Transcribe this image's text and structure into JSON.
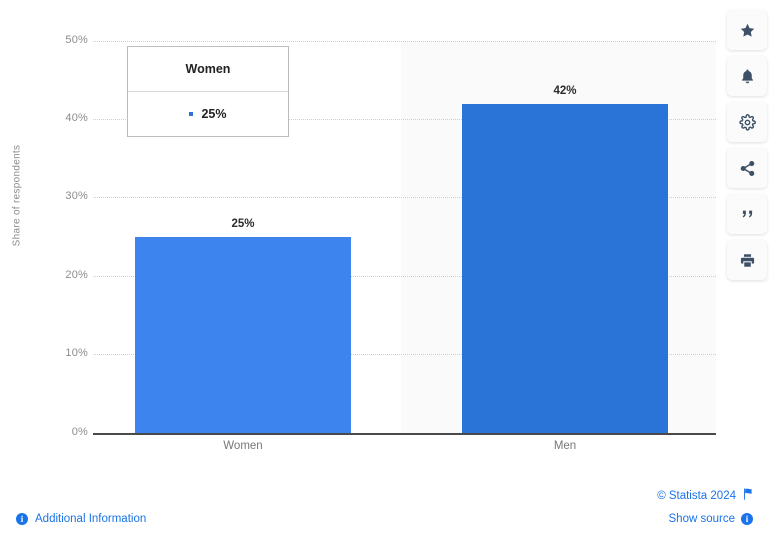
{
  "chart_data": {
    "type": "bar",
    "categories": [
      "Women",
      "Men"
    ],
    "values": [
      25,
      42
    ],
    "value_labels": [
      "25%",
      "42%"
    ],
    "title": "",
    "xlabel": "",
    "ylabel": "Share of respondents",
    "ylim": [
      0,
      50
    ],
    "ytick_labels": [
      "0%",
      "10%",
      "20%",
      "30%",
      "40%",
      "50%"
    ],
    "ytick_values": [
      0,
      10,
      20,
      30,
      40,
      50
    ],
    "grid": true,
    "legend": "none",
    "series_colors": [
      "#3d84ef",
      "#2974d6"
    ],
    "highlighted_category": "Men"
  },
  "tooltip": {
    "header": "Women",
    "value": "25%",
    "marker_color": "#2974d6"
  },
  "action_rail": [
    {
      "name": "star-icon",
      "label": "Add to favorites"
    },
    {
      "name": "bell-icon",
      "label": "Notifications"
    },
    {
      "name": "gear-icon",
      "label": "Settings"
    },
    {
      "name": "share-icon",
      "label": "Share"
    },
    {
      "name": "quote-icon",
      "label": "Citation"
    },
    {
      "name": "print-icon",
      "label": "Print"
    }
  ],
  "footer": {
    "copyright": "© Statista 2024",
    "show_source": "Show source",
    "additional_information": "Additional Information",
    "info_glyph": "i",
    "link_color": "#1a73e8"
  }
}
